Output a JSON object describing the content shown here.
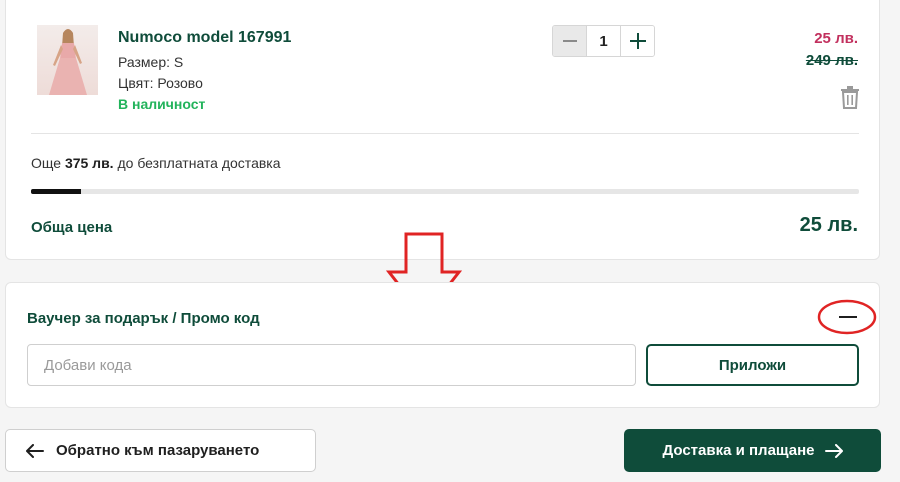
{
  "cart_item": {
    "name": "Numoco model 167991",
    "size": "Размер: S",
    "color": "Цвят: Розово",
    "stock": "В наличност",
    "quantity": "1",
    "quantity_minus_icon": "minus-icon",
    "quantity_plus_icon": "plus-icon",
    "price_new": "25 лв.",
    "price_old": "249 лв.",
    "delete_icon": "trash-icon"
  },
  "shipping": {
    "prefix": "Още",
    "amount": "375 лв.",
    "suffix": "до безплатната доставка",
    "progress_percent": 6
  },
  "total": {
    "label": "Обща цена",
    "value": "25 лв."
  },
  "voucher": {
    "title": "Ваучер за подарък / Промо код",
    "toggle_icon": "minus-icon",
    "input_placeholder": "Добави кода",
    "input_value": "",
    "apply_label": "Приложи"
  },
  "navigation": {
    "back_label": "Обратно към пазаруването",
    "back_icon": "arrow-left-icon",
    "next_label": "Доставка и плащане",
    "next_icon": "arrow-right-icon"
  },
  "colors": {
    "brand_green": "#0f4c3a",
    "price_red": "#c2305e",
    "stock_green": "#22b35b",
    "annotation_red": "#e02424"
  }
}
